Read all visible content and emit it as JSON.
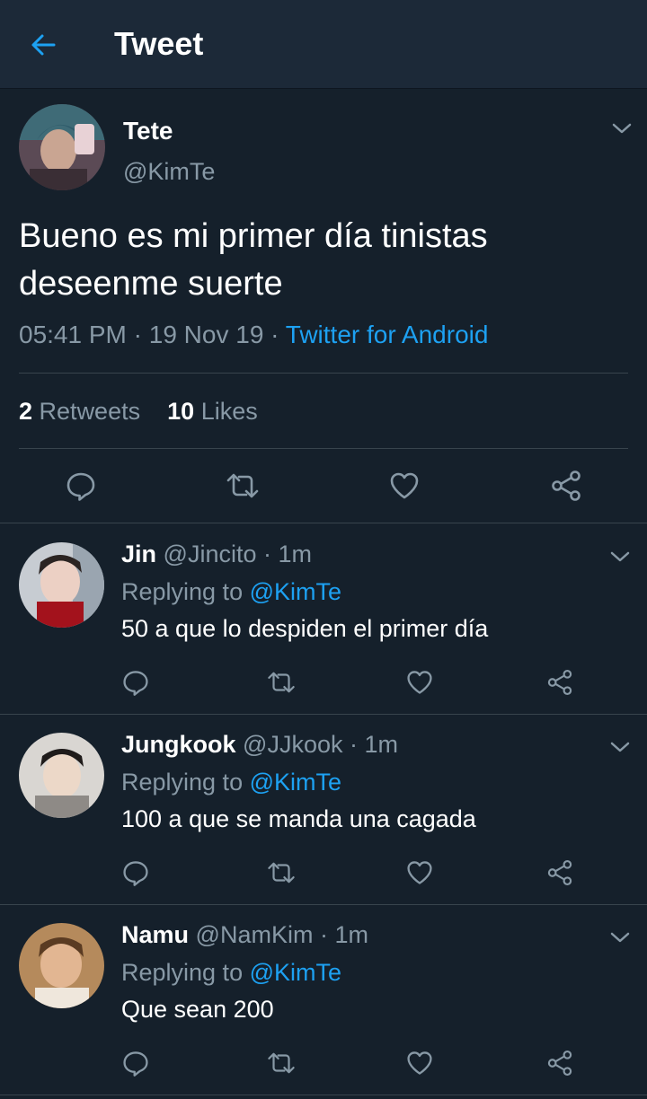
{
  "header": {
    "title": "Tweet",
    "back_icon": "arrow-left-icon",
    "accent": "#1da1f2"
  },
  "tweet": {
    "name": "Tete",
    "handle": "@KimTe",
    "text": "Bueno es mi primer día tinistas deseenme suerte",
    "time": "05:41 PM",
    "date": "19 Nov 19",
    "sep": "·",
    "source": "Twitter for Android",
    "retweets_count": "2",
    "retweets_label": "Retweets",
    "likes_count": "10",
    "likes_label": "Likes"
  },
  "replies": [
    {
      "name": "Jin",
      "handle": "@Jincito",
      "time": "· 1m",
      "replying_label": "Replying to",
      "mention": "@KimTe",
      "text": "50 a que lo despiden el primer día"
    },
    {
      "name": "Jungkook",
      "handle": "@JJkook",
      "time": "· 1m",
      "replying_label": "Replying to",
      "mention": "@KimTe",
      "text": "100 a que se manda una cagada"
    },
    {
      "name": "Namu",
      "handle": "@NamKim",
      "time": "· 1m",
      "replying_label": "Replying to",
      "mention": "@KimTe",
      "text": "Que sean 200"
    }
  ],
  "colors": {
    "background": "#15202b",
    "header": "#1c2938",
    "muted": "#8899a6",
    "link": "#1da1f2",
    "divider": "#38444d"
  },
  "icons": [
    "arrow-left-icon",
    "chevron-down-icon",
    "reply-icon",
    "retweet-icon",
    "like-icon",
    "share-icon"
  ]
}
